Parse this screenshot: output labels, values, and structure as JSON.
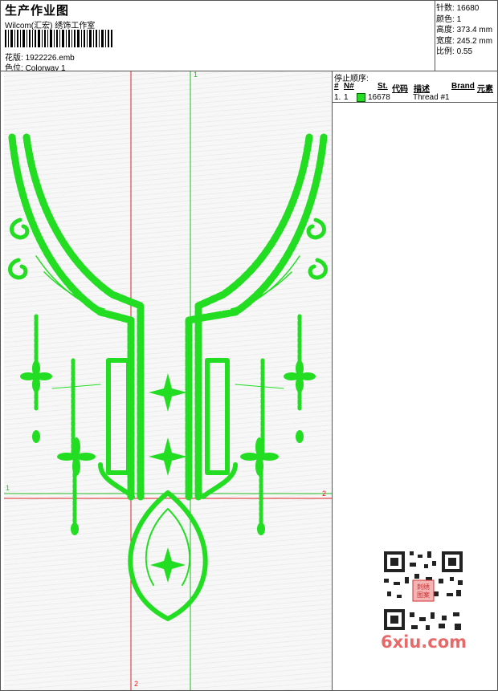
{
  "header": {
    "title": "生产作业图",
    "company": "Wilcom(汇宏) 绣饰工作室",
    "design_label": "花版:",
    "design_value": "1922226.emb",
    "colorway_label": "色位:",
    "colorway_value": "Colorway 1"
  },
  "stats": {
    "stitches_label": "针数:",
    "stitches_value": "16680",
    "colors_label": "颜色:",
    "colors_value": "1",
    "height_label": "高度:",
    "height_value": "373.4 mm",
    "width_label": "宽度:",
    "width_value": "245.2 mm",
    "scale_label": "比例:",
    "scale_value": "0.55"
  },
  "sequence": {
    "title": "停止顺序:",
    "columns": [
      "#",
      "N#",
      "St.",
      "代码",
      "描述",
      "Brand",
      "元素"
    ],
    "rows": [
      {
        "index": "1.",
        "needle": "1",
        "code": "16678",
        "color": "#22dd22",
        "description": "Thread #1"
      }
    ]
  },
  "guides": {
    "v1_label": "1",
    "h1_label": "1",
    "h2_label": "2",
    "v2_label": "2"
  },
  "watermark": {
    "text": "6xiu.com",
    "qr_stamp": "刺绣图案"
  },
  "colors": {
    "embroidery": "#22dd22",
    "guide_red": "#e02020",
    "guide_green": "#22bb22"
  }
}
